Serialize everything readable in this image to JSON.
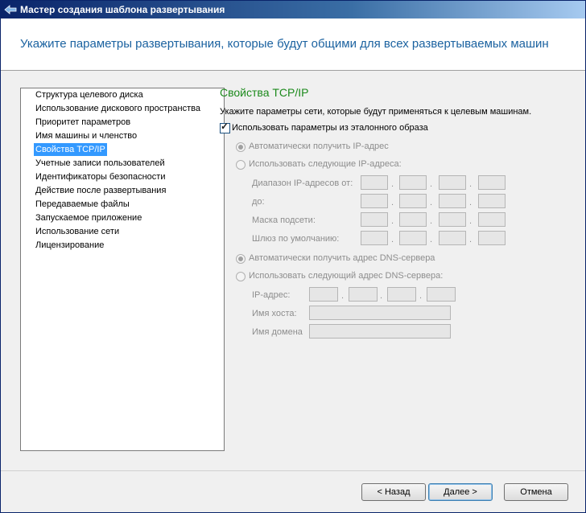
{
  "window": {
    "title": "Мастер создания шаблона развертывания"
  },
  "header": {
    "heading": "Укажите параметры развертывания, которые будут общими для всех развертываемых машин"
  },
  "nav": {
    "items": [
      "Структура целевого диска",
      "Использование дискового пространства",
      "Приоритет параметров",
      "Имя машины и членство",
      "Свойства TCP/IP",
      "Учетные записи пользователей",
      "Идентификаторы безопасности",
      "Действие после развертывания",
      "Передаваемые файлы",
      "Запускаемое приложение",
      "Использование сети",
      "Лицензирование"
    ],
    "selected": "Свойства TCP/IP"
  },
  "tcpip": {
    "title": "Свойства TCP/IP",
    "description": "Укажите параметры сети, которые будут применяться к целевым машинам.",
    "use_master": {
      "label": "Использовать параметры из эталонного образа",
      "checked": true
    },
    "ip_auto": {
      "label": "Автоматически получить IP-адрес",
      "selected": true
    },
    "ip_manual": {
      "label": "Использовать следующие IP-адреса:",
      "selected": false
    },
    "range_from_label": "Диапазон IP-адресов от:",
    "range_to_label": "до:",
    "subnet_label": "Маска подсети:",
    "gateway_label": "Шлюз по умолчанию:",
    "dns_auto": {
      "label": "Автоматически получить адрес DNS-сервера",
      "selected": true
    },
    "dns_manual": {
      "label": "Использовать следующий адрес DNS-сервера:",
      "selected": false
    },
    "dns_ip_label": "IP-адрес:",
    "hostname_label": "Имя хоста:",
    "domain_label": "Имя домена"
  },
  "buttons": {
    "back": "< Назад",
    "next": "Далее >",
    "cancel": "Отмена"
  }
}
